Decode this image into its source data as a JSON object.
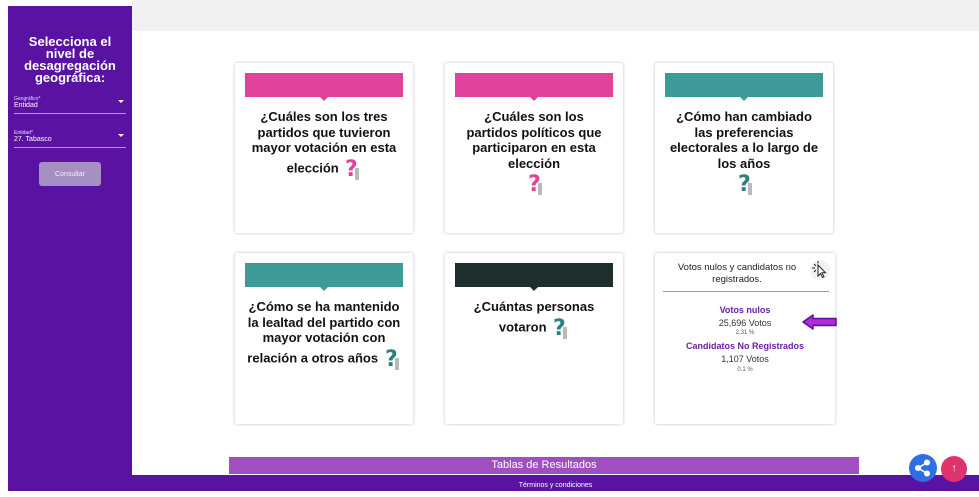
{
  "sidebar": {
    "title": "Selecciona el nivel de desagregación geográfica:",
    "geo_field": {
      "label": "Geográfico*",
      "value": "Entidad"
    },
    "entity_field": {
      "label": "Entidad*",
      "value": "27. Tabasco"
    },
    "consult_button": "Consultar"
  },
  "cards": [
    {
      "question": "¿Cuáles son los tres partidos que tuvieron mayor votación en esta elección",
      "band_color": "#e1429b"
    },
    {
      "question": "¿Cuáles son los partidos políticos que participaron en esta elección",
      "band_color": "#e1429b"
    },
    {
      "question": "¿Cómo han cambiado las preferencias electorales a lo largo de los años",
      "band_color": "#3d9a99"
    },
    {
      "question": "¿Cómo se ha mantenido la lealtad del partido con mayor votación con relación a otros años",
      "band_color": "#3d9a99"
    },
    {
      "question": "¿Cuántas personas votaron",
      "band_color": "#1e2e2d"
    }
  ],
  "votes_card": {
    "title": "Votos nulos y candidatos no registrados.",
    "null_label": "Votos nulos",
    "null_votes": "25,696 Votos",
    "null_pct": "2.31 %",
    "unreg_label": "Candidatos No Registrados",
    "unreg_votes": "1,107 Votos",
    "unreg_pct": "0.1 %"
  },
  "results_bar": "Tablas de Resultados",
  "footer": {
    "terms": "Términos y condiciones"
  },
  "colors": {
    "sidebar": "#5a12a3",
    "pink": "#e1429b",
    "teal": "#3d9a99",
    "dark": "#1e2e2d",
    "purple_accent": "#6a1fa8"
  },
  "icons": [
    "question-person-icon",
    "pointer-click-icon",
    "arrow-left-icon",
    "share-icon",
    "arrow-up-icon"
  ]
}
